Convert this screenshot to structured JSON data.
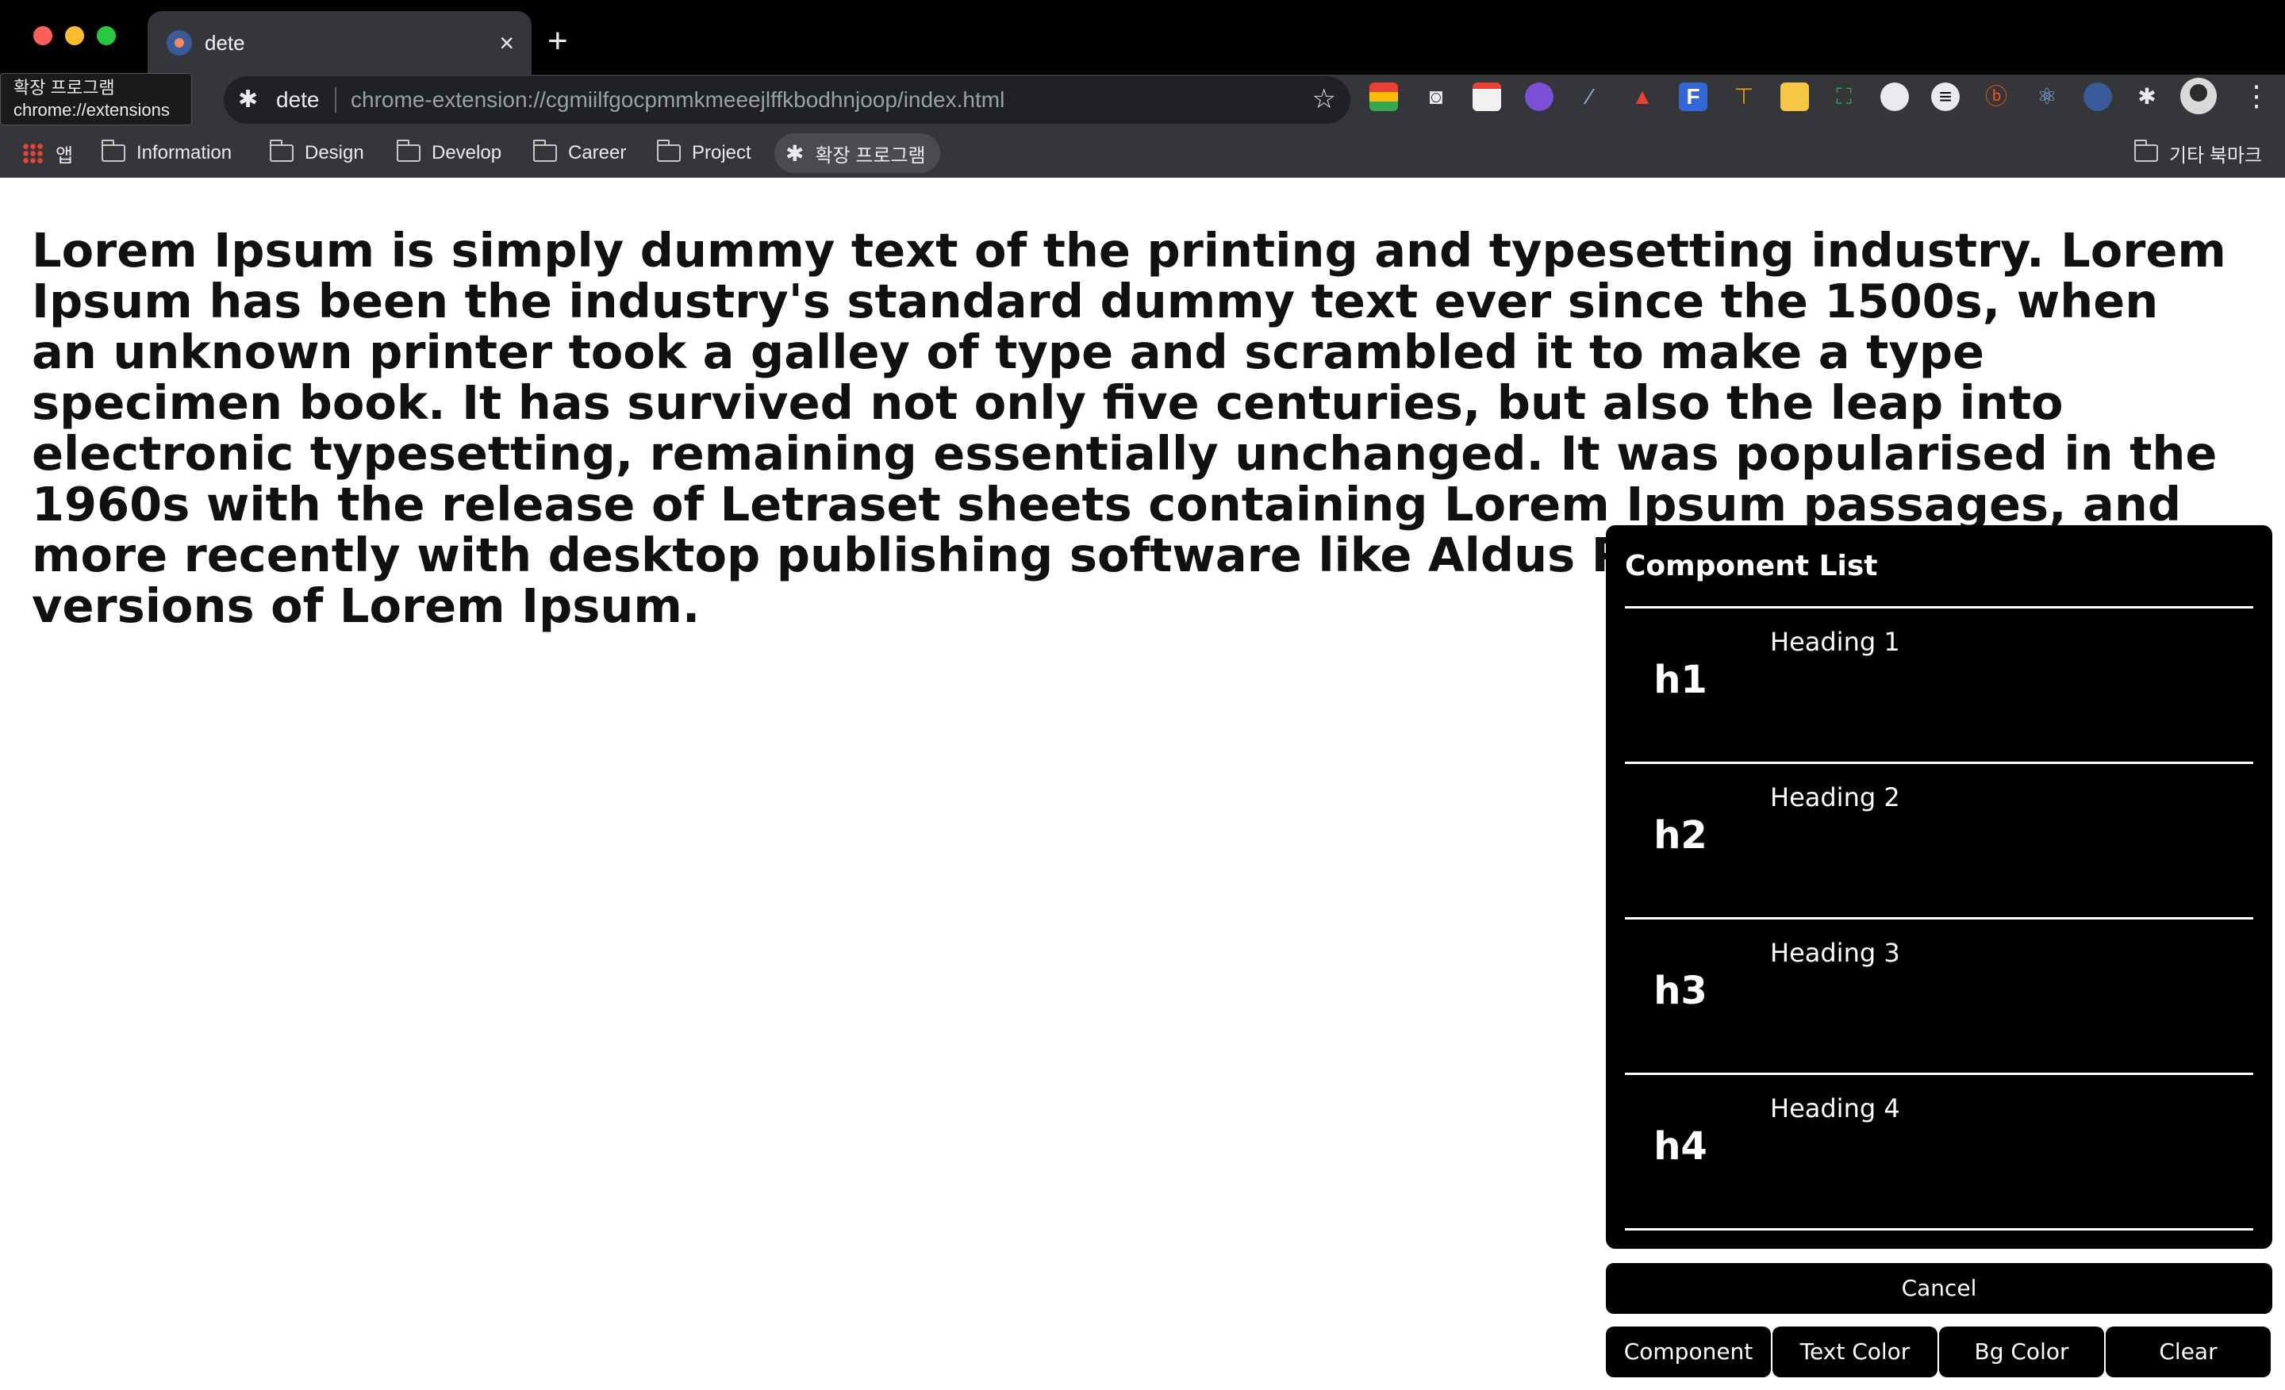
{
  "browser": {
    "tab": {
      "title": "dete",
      "close": "×"
    },
    "new_tab": "+",
    "tooltip": {
      "line1": "확장 프로그램",
      "line2": "chrome://extensions"
    },
    "omnibox": {
      "extension_name": "dete",
      "url": "chrome-extension://cgmiilfgocpmmkmeeejlffkbodhnjoop/index.html",
      "star": "☆"
    },
    "menu": "⋮",
    "bookmarks": [
      {
        "label": "앱",
        "icon": "apps-grid-icon"
      },
      {
        "label": "Information",
        "icon": "folder-icon"
      },
      {
        "label": "Design",
        "icon": "folder-icon"
      },
      {
        "label": "Develop",
        "icon": "folder-icon"
      },
      {
        "label": "Career",
        "icon": "folder-icon"
      },
      {
        "label": "Project",
        "icon": "folder-icon"
      },
      {
        "label": "확장 프로그램",
        "icon": "puzzle-icon"
      }
    ],
    "other_bookmarks": "기타 북마크"
  },
  "page": {
    "body_text": "Lorem Ipsum is simply dummy text of the printing and typesetting industry. Lorem Ipsum has been the industry's standard dummy text ever since the 1500s, when an unknown printer took a galley of type and scrambled it to make a type specimen book. It has survived not only five centuries, but also the leap into electronic typesetting, remaining essentially unchanged. It was popularised in the 1960s with the release of Letraset sheets containing Lorem Ipsum passages, and more recently with desktop publishing software like Aldus PageMaker including versions of Lorem Ipsum."
  },
  "panel": {
    "title": "Component List",
    "items": [
      {
        "tag": "h1",
        "label": "Heading 1"
      },
      {
        "tag": "h2",
        "label": "Heading 2"
      },
      {
        "tag": "h3",
        "label": "Heading 3"
      },
      {
        "tag": "h4",
        "label": "Heading 4"
      }
    ],
    "cancel": "Cancel",
    "buttons": {
      "component": "Component",
      "text_color": "Text Color",
      "bg_color": "Bg Color",
      "clear": "Clear"
    }
  }
}
